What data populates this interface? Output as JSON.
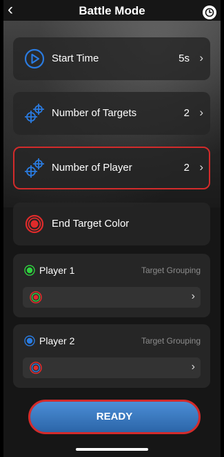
{
  "header": {
    "title": "Battle Mode"
  },
  "rows": {
    "start_time": {
      "label": "Start Time",
      "value": "5s"
    },
    "targets": {
      "label": "Number of Targets",
      "value": "2"
    },
    "players": {
      "label": "Number of Player",
      "value": "2"
    },
    "end_color": {
      "label": "End Target Color"
    }
  },
  "players": [
    {
      "name": "Player 1",
      "meta": "Target Grouping",
      "color": "#2fd23f"
    },
    {
      "name": "Player 2",
      "meta": "Target Grouping",
      "color": "#2a7be0"
    }
  ],
  "ready_label": "READY",
  "colors": {
    "accent_red": "#d32b2b",
    "accent_blue": "#2a7be0"
  }
}
